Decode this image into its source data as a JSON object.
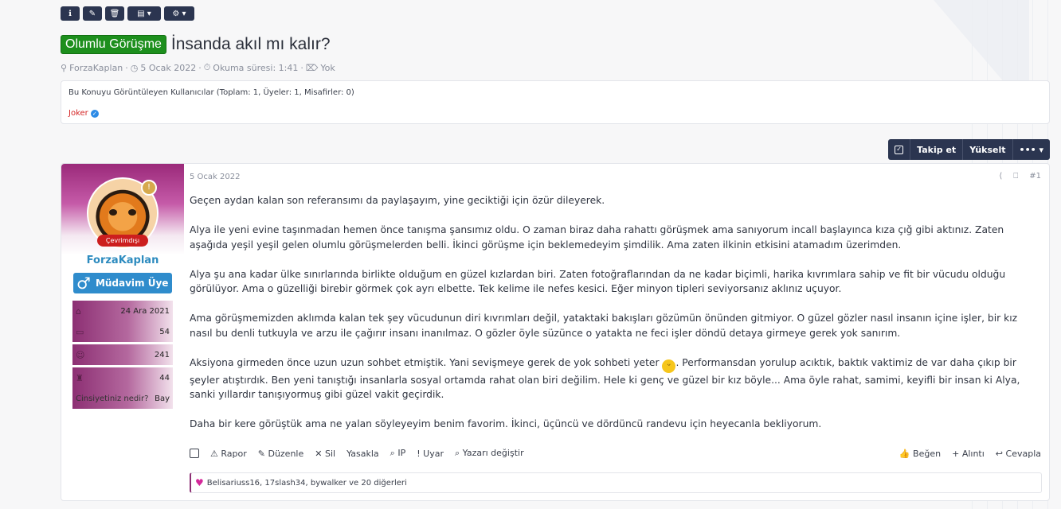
{
  "thread": {
    "prefix": "Olumlu Görüşme",
    "title": "İnsanda akıl mı kalır?",
    "author": "ForzaKaplan",
    "date": "5 Ocak 2022",
    "reading_time": "Okuma süresi: 1:41",
    "tags": "Yok"
  },
  "mod_toolbar": {
    "icons": [
      "info-icon",
      "edit-icon",
      "trash-icon",
      "chart-icon",
      "gear-icon"
    ]
  },
  "viewers": {
    "summary": "Bu Konuyu Görüntüleyen Kullanıcılar (Toplam: 1, Üyeler: 1, Misafirler: 0)",
    "users": [
      "Joker"
    ]
  },
  "actions": {
    "watch": "Takip et",
    "bump": "Yükselt",
    "more": "•••"
  },
  "user": {
    "status": "Çevrimdışı",
    "name": "ForzaKaplan",
    "title": "Müdavim Üye",
    "stats": [
      {
        "icon": "home-icon",
        "label": "",
        "value": "24 Ara 2021"
      },
      {
        "icon": "message-icon",
        "label": "",
        "value": "54"
      },
      {
        "icon": "reaction-icon",
        "label": "",
        "value": "241"
      },
      {
        "icon": "trophy-icon",
        "label": "",
        "value": "44"
      },
      {
        "icon": "",
        "label": "Cinsiyetiniz nedir?",
        "value": "Bay"
      }
    ]
  },
  "post": {
    "date": "5 Ocak 2022",
    "number": "#1",
    "paragraphs": [
      "Geçen aydan kalan son referansımı da paylaşayım, yine geciktiği için özür dileyerek.",
      "Alya ile yeni evine taşınmadan hemen önce tanışma şansımız oldu. O zaman biraz daha rahattı görüşmek ama sanıyorum incall başlayınca kıza çığ gibi aktınız. Zaten aşağıda yeşil yeşil gelen olumlu görüşmelerden belli. İkinci görüşme için beklemedeyim şimdilik. Ama zaten ilkinin etkisini atamadım üzerimden.",
      "Alya şu ana kadar ülke sınırlarında birlikte olduğum en güzel kızlardan biri. Zaten fotoğraflarından da ne kadar biçimli, harika kıvrımlara sahip ve fit bir vücudu olduğu görülüyor. Ama o güzelliği birebir görmek çok ayrı elbette. Tek kelime ile nefes kesici. Eğer minyon tipleri seviyorsanız aklınız uçuyor.",
      "Ama görüşmemizden aklımda kalan tek şey vücudunun diri kıvrımları değil, yataktaki bakışları gözümün önünden gitmiyor. O güzel gözler nasıl insanın içine işler, bir kız nasıl bu denli tutkuyla ve arzu ile çağırır insanı inanılmaz. O gözler öyle süzünce o yatakta ne feci işler döndü detaya girmeye gerek yok sanırım."
    ],
    "p5_a": "Aksiyona girmeden önce uzun uzun sohbet etmiştik. Yani sevişmeye gerek de yok sohbeti yeter ",
    "p5_b": ". Performansdan yorulup acıktık, baktık vaktimiz de var daha çıkıp bir şeyler atıştırdık. Ben yeni tanıştığı insanlarla sosyal ortamda rahat olan biri değilim. Hele ki genç ve güzel bir kız böyle... Ama öyle rahat, samimi, keyifli bir insan ki Alya, sanki yıllardır tanışıyormuş gibi güzel vakit geçirdik.",
    "p6": "Daha bir kere görüştük ama ne yalan söyleyeyim benim favorim. İkinci, üçüncü ve dördüncü randevu için heyecanla bekliyorum."
  },
  "post_actions": {
    "report": "Rapor",
    "edit": "Düzenle",
    "delete": "Sil",
    "ban": "Yasakla",
    "ip": "IP",
    "warn": "Uyar",
    "change_author": "Yazarı değiştir",
    "like": "Beğen",
    "quote": "Alıntı",
    "reply": "Cevapla"
  },
  "reactions": {
    "text": "Belisariuss16, 17slash34, bywalker ve 20 diğerleri"
  }
}
